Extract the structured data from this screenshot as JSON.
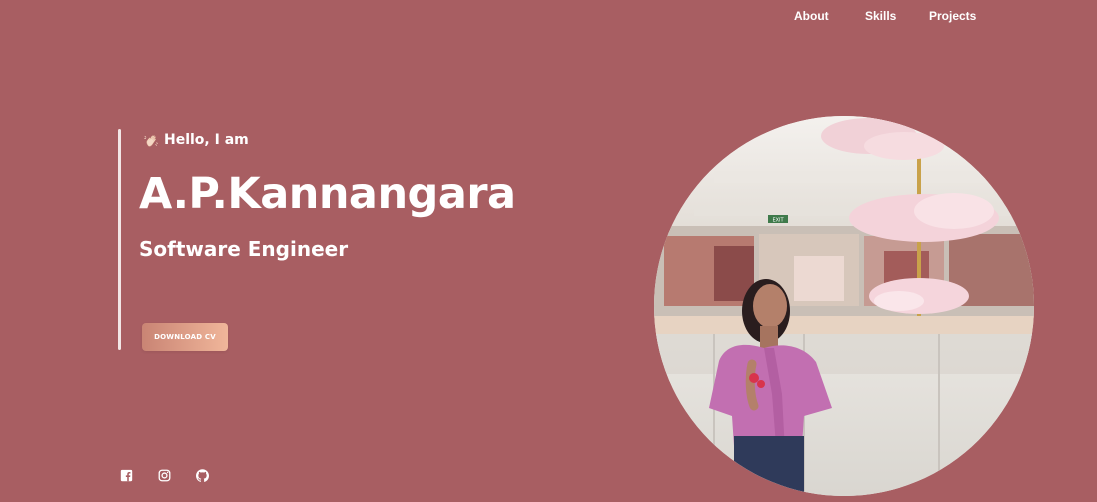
{
  "nav": {
    "items": [
      {
        "label": "About"
      },
      {
        "label": "Skills"
      },
      {
        "label": "Projects"
      }
    ]
  },
  "hero": {
    "greeting": "Hello, I am",
    "name": "A.P.Kannangara",
    "role": "Software Engineer",
    "download_label": "DOWNLOAD CV"
  },
  "socials": [
    {
      "icon": "facebook-icon"
    },
    {
      "icon": "instagram-icon"
    },
    {
      "icon": "github-icon"
    }
  ],
  "portrait": {
    "sign_text": "EXIT"
  },
  "colors": {
    "background": "#a85e62",
    "accent_line": "#f3e6e6",
    "button_start": "#c98474",
    "button_end": "#f0b69a",
    "text": "#ffffff"
  }
}
